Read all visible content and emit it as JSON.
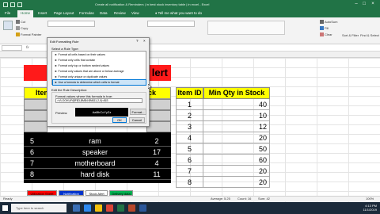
{
  "window": {
    "title": "Create all notification & Reminders | in best stock inventory table | in excel - Excel",
    "tell_me": "Tell me what you want to do"
  },
  "ribbon_tabs": [
    "File",
    "Home",
    "Insert",
    "Page Layout",
    "Formulas",
    "Data",
    "Review",
    "View"
  ],
  "ribbon": {
    "cut": "Cut",
    "copy": "Copy",
    "format_painter": "Format Painter",
    "autosum": "AutoSum",
    "fill": "Fill",
    "clear": "Clear",
    "sort_filter": "Sort & Filter",
    "find_select": "Find & Select"
  },
  "formula_bar": {
    "name_box": "",
    "fx": "fx"
  },
  "banner": {
    "title": "lert"
  },
  "left_table": {
    "header_left": "Item",
    "header_right": "ck",
    "black_rows": [
      {
        "id": "5",
        "name": "ram",
        "qty": "2"
      },
      {
        "id": "6",
        "name": "speaker",
        "qty": "17"
      },
      {
        "id": "7",
        "name": "motherboard",
        "qty": "4"
      },
      {
        "id": "8",
        "name": "hard disk",
        "qty": "11"
      }
    ]
  },
  "right_table": {
    "header_id": "Item ID",
    "header_qty": "Min Qty in Stock",
    "rows": [
      {
        "id": "1",
        "qty": "40"
      },
      {
        "id": "2",
        "qty": "10"
      },
      {
        "id": "3",
        "qty": "12"
      },
      {
        "id": "4",
        "qty": "20"
      },
      {
        "id": "5",
        "qty": "50"
      },
      {
        "id": "6",
        "qty": "60"
      },
      {
        "id": "7",
        "qty": "20"
      },
      {
        "id": "8",
        "qty": "20"
      }
    ]
  },
  "dialog": {
    "title": "Edit Formatting Rule",
    "help": "?",
    "close": "×",
    "select_label": "Select a Rule Type:",
    "rules": [
      "► Format all cells based on their values",
      "► Format only cells that contain",
      "► Format only top or bottom ranked values",
      "► Format only values that are above or below average",
      "► Format only unique or duplicate values",
      "► Use a formula to determine which cells to format"
    ],
    "selected_index": 5,
    "edit_label": "Edit the Rule Description:",
    "format_values_label": "Format values where this formula is true:",
    "formula": "=VLOOKUP($F$3,$M$4:$N$11,2,0)<$I3",
    "preview_label": "Preview:",
    "preview_text": "AaBbCcYyZz",
    "format_button": "Format...",
    "ok": "OK",
    "cancel": "Cancel"
  },
  "sheets": [
    {
      "label": "Utilization Sheet",
      "bg": "#ff0000",
      "fg": "#000000"
    },
    {
      "label": "Notification",
      "bg": "#0033cc",
      "fg": "#ffffff"
    },
    {
      "label": "Stock Alert",
      "bg": "#ffffff",
      "fg": "#000000"
    },
    {
      "label": "Delivery data",
      "bg": "#00b050",
      "fg": "#000000"
    }
  ],
  "status": {
    "ready": "Ready",
    "average": "Average: 5.25",
    "count": "Count: 16",
    "sum": "Sum: 42",
    "zoom": "100%"
  },
  "taskbar": {
    "search_placeholder": "Type here to search",
    "time": "4:13 PM",
    "date": "11/1/2019"
  },
  "colors": {
    "excel_green": "#217346",
    "banner_red": "#ff1a1a",
    "header_yellow": "#ffff00",
    "selection_blue": "#0078d7"
  }
}
